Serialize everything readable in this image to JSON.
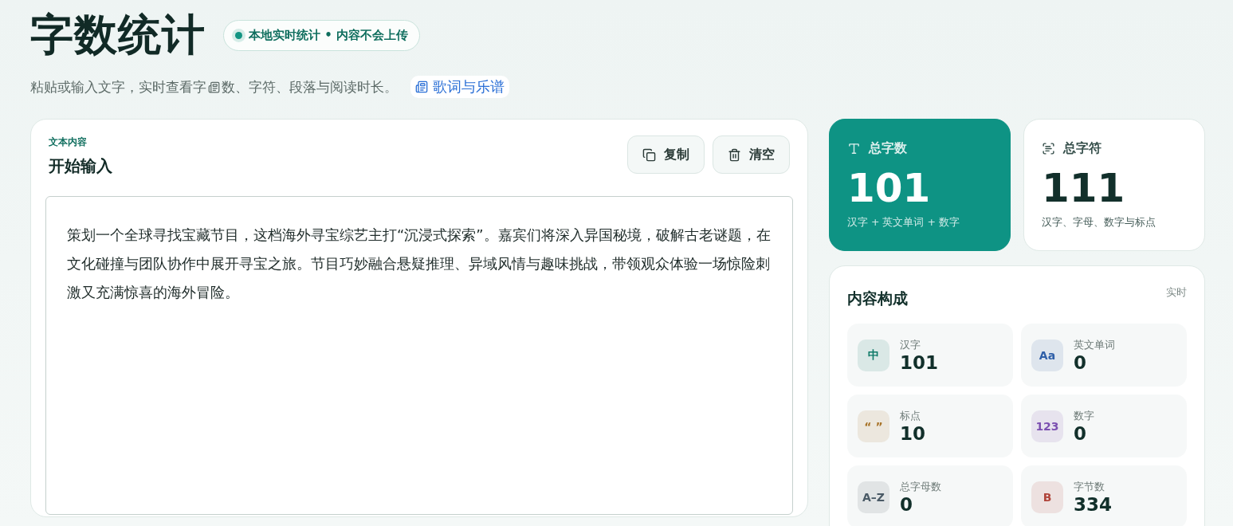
{
  "header": {
    "title": "字数统计",
    "badge": "本地实时统计 • 内容不会上传",
    "subtitle_before": "粘贴或输入文字，实时查看字",
    "subtitle_after": "数、字符、段落与阅读时长。",
    "link": "歌词与乐谱"
  },
  "editor": {
    "eyebrow": "文本内容",
    "title": "开始输入",
    "buttons": [
      {
        "kind": "copy",
        "label": "复制"
      },
      {
        "kind": "clear",
        "label": "清空"
      }
    ],
    "value": "策划一个全球寻找宝藏节目，这档海外寻宝综艺主打“沉浸式探索”。嘉宾们将深入异国秘境，破解古老谜题，在文化碰撞与团队协作中展开寻宝之旅。节目巧妙融合悬疑推理、异域风情与趣味挑战，带领观众体验一场惊险刺激又充满惊喜的海外冒险。"
  },
  "stats": [
    {
      "kind": "words",
      "label": "总字数",
      "value": "101",
      "note": "汉字 + 英文单词 + 数字",
      "selected": true
    },
    {
      "kind": "chars",
      "label": "总字符",
      "value": "111",
      "note": "汉字、字母、数字与标点",
      "selected": false
    }
  ],
  "composition": {
    "title": "内容构成",
    "tag": "实时",
    "items": [
      {
        "glyph": "中",
        "label": "汉字",
        "value": "101",
        "color": "#0f7a68"
      },
      {
        "glyph": "Aa",
        "label": "英文单词",
        "value": "0",
        "color": "#2f5fa8"
      },
      {
        "glyph": "“ ”",
        "label": "标点",
        "value": "10",
        "color": "#a8742a"
      },
      {
        "glyph": "123",
        "label": "数字",
        "value": "0",
        "color": "#7b4fb0"
      },
      {
        "glyph": "A–Z",
        "label": "总字母数",
        "value": "0",
        "color": "#4a5a66"
      },
      {
        "glyph": "B",
        "label": "字节数",
        "value": "334",
        "color": "#b0443a"
      }
    ]
  }
}
